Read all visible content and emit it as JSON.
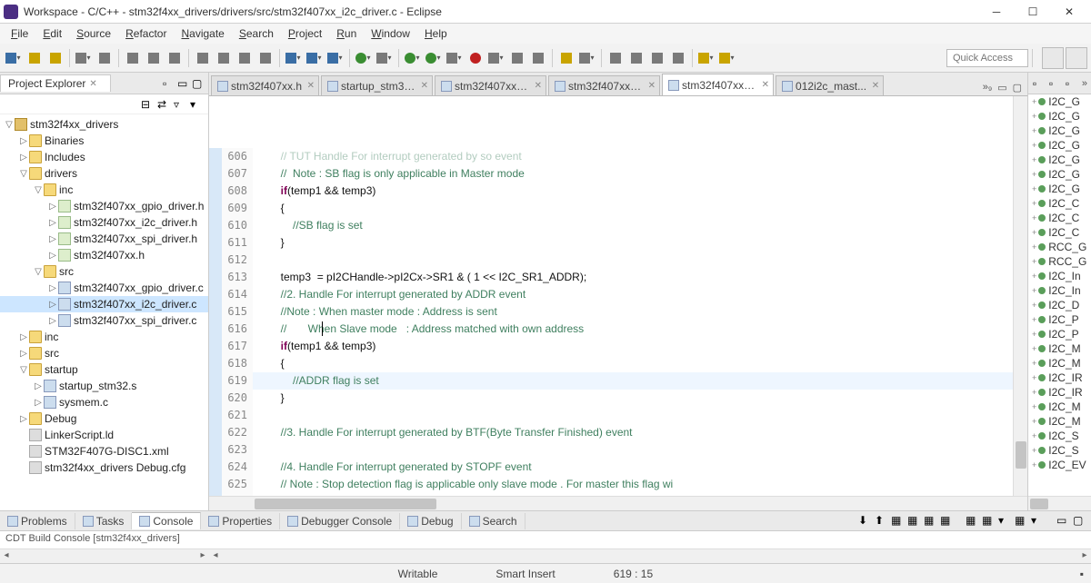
{
  "window": {
    "title": "Workspace - C/C++ - stm32f4xx_drivers/drivers/src/stm32f407xx_i2c_driver.c - Eclipse"
  },
  "menu": [
    "File",
    "Edit",
    "Source",
    "Refactor",
    "Navigate",
    "Search",
    "Project",
    "Run",
    "Window",
    "Help"
  ],
  "quick_access": "Quick Access",
  "project_explorer": {
    "title": "Project Explorer",
    "tree": [
      {
        "lvl": 0,
        "exp": "▽",
        "ico": "prj",
        "label": "stm32f4xx_drivers"
      },
      {
        "lvl": 1,
        "exp": "▷",
        "ico": "fld",
        "label": "Binaries"
      },
      {
        "lvl": 1,
        "exp": "▷",
        "ico": "fld",
        "label": "Includes"
      },
      {
        "lvl": 1,
        "exp": "▽",
        "ico": "fld",
        "label": "drivers"
      },
      {
        "lvl": 2,
        "exp": "▽",
        "ico": "fld",
        "label": "inc"
      },
      {
        "lvl": 3,
        "exp": "▷",
        "ico": "h",
        "label": "stm32f407xx_gpio_driver.h"
      },
      {
        "lvl": 3,
        "exp": "▷",
        "ico": "h",
        "label": "stm32f407xx_i2c_driver.h"
      },
      {
        "lvl": 3,
        "exp": "▷",
        "ico": "h",
        "label": "stm32f407xx_spi_driver.h"
      },
      {
        "lvl": 3,
        "exp": "▷",
        "ico": "h",
        "label": "stm32f407xx.h"
      },
      {
        "lvl": 2,
        "exp": "▽",
        "ico": "fld",
        "label": "src"
      },
      {
        "lvl": 3,
        "exp": "▷",
        "ico": "c",
        "label": "stm32f407xx_gpio_driver.c"
      },
      {
        "lvl": 3,
        "exp": "▷",
        "ico": "c",
        "label": "stm32f407xx_i2c_driver.c",
        "sel": true
      },
      {
        "lvl": 3,
        "exp": "▷",
        "ico": "c",
        "label": "stm32f407xx_spi_driver.c"
      },
      {
        "lvl": 1,
        "exp": "▷",
        "ico": "fld",
        "label": "inc"
      },
      {
        "lvl": 1,
        "exp": "▷",
        "ico": "fld",
        "label": "src"
      },
      {
        "lvl": 1,
        "exp": "▽",
        "ico": "fld",
        "label": "startup"
      },
      {
        "lvl": 2,
        "exp": "▷",
        "ico": "c",
        "label": "startup_stm32.s"
      },
      {
        "lvl": 2,
        "exp": "▷",
        "ico": "c",
        "label": "sysmem.c"
      },
      {
        "lvl": 1,
        "exp": "▷",
        "ico": "fld",
        "label": "Debug"
      },
      {
        "lvl": 1,
        "exp": " ",
        "ico": "x",
        "label": "LinkerScript.ld"
      },
      {
        "lvl": 1,
        "exp": " ",
        "ico": "x",
        "label": "STM32F407G-DISC1.xml"
      },
      {
        "lvl": 1,
        "exp": " ",
        "ico": "x",
        "label": "stm32f4xx_drivers Debug.cfg"
      }
    ]
  },
  "editor_tabs": [
    {
      "label": "stm32f407xx.h"
    },
    {
      "label": "startup_stm32.s"
    },
    {
      "label": "stm32f407xx_..."
    },
    {
      "label": "stm32f407xx_..."
    },
    {
      "label": "stm32f407xx_...",
      "active": true
    },
    {
      "label": "012i2c_mast..."
    }
  ],
  "editor_overflow": "»₉",
  "code": [
    {
      "n": 606,
      "txt": "// TUT Handle For interrupt generated by so event",
      "cm": true,
      "dim": true
    },
    {
      "n": 607,
      "txt": "//  Note : SB flag is only applicable in Master mode",
      "cm": true
    },
    {
      "n": 608,
      "seg": [
        {
          "t": "if",
          "c": "kw"
        },
        {
          "t": "(temp1 && temp3)"
        }
      ]
    },
    {
      "n": 609,
      "txt": "{"
    },
    {
      "n": 610,
      "txt": "    //SB flag is set",
      "cm": true
    },
    {
      "n": 611,
      "txt": "}"
    },
    {
      "n": 612,
      "txt": ""
    },
    {
      "n": 613,
      "seg": [
        {
          "t": "temp3  = pI2CHandle->pI2Cx->SR1 & ( 1 << I2C_SR1_ADDR);"
        }
      ]
    },
    {
      "n": 614,
      "txt": "//2. Handle For interrupt generated by ADDR event",
      "cm": true
    },
    {
      "n": 615,
      "txt": "//Note : When master mode : Address is sent",
      "cm": true
    },
    {
      "n": 616,
      "txt": "//       When Slave mode   : Address matched with own address",
      "cm": true
    },
    {
      "n": 617,
      "seg": [
        {
          "t": "if",
          "c": "kw"
        },
        {
          "t": "(temp1 && temp3)"
        }
      ]
    },
    {
      "n": 618,
      "txt": "{"
    },
    {
      "n": 619,
      "txt": "    //ADDR flag is set",
      "cm": true,
      "hl": true
    },
    {
      "n": 620,
      "txt": "}"
    },
    {
      "n": 621,
      "txt": ""
    },
    {
      "n": 622,
      "txt": "//3. Handle For interrupt generated by BTF(Byte Transfer Finished) event",
      "cm": true
    },
    {
      "n": 623,
      "txt": ""
    },
    {
      "n": 624,
      "txt": "//4. Handle For interrupt generated by STOPF event",
      "cm": true
    },
    {
      "n": 625,
      "txt": "// Note : Stop detection flag is applicable only slave mode . For master this flag wi",
      "cm": true
    },
    {
      "n": 626,
      "txt": ""
    },
    {
      "n": 627,
      "txt": "//5. Handle For interrupt generated by TXE event",
      "cm": true
    },
    {
      "n": 628,
      "txt": ""
    }
  ],
  "outline": [
    "I2C_G",
    "I2C_G",
    "I2C_G",
    "I2C_G",
    "I2C_G",
    "I2C_G",
    "I2C_G",
    "I2C_C",
    "I2C_C",
    "I2C_C",
    "RCC_G",
    "RCC_G",
    "I2C_In",
    "I2C_In",
    "I2C_D",
    "I2C_P",
    "I2C_P",
    "I2C_M",
    "I2C_M",
    "I2C_IR",
    "I2C_IR",
    "I2C_M",
    "I2C_M",
    "I2C_S",
    "I2C_S",
    "I2C_EV"
  ],
  "bottom_tabs": [
    "Problems",
    "Tasks",
    "Console",
    "Properties",
    "Debugger Console",
    "Debug",
    "Search"
  ],
  "bottom_active": 2,
  "console_title": "CDT Build Console [stm32f4xx_drivers]",
  "status": {
    "writable": "Writable",
    "insert": "Smart Insert",
    "pos": "619 : 15"
  }
}
